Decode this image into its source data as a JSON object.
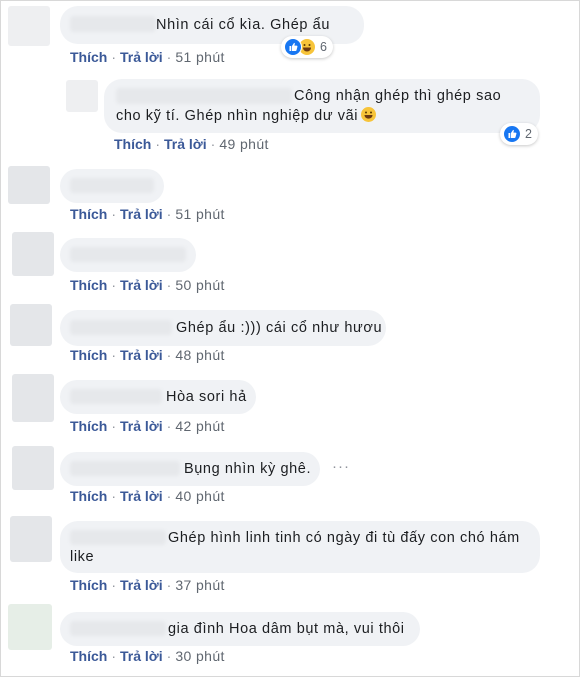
{
  "colors": {
    "link": "#3b5998",
    "bubble": "#f0f2f5",
    "time": "#606770",
    "like_blue": "#1877f2",
    "haha_yellow": "#f7c43a"
  },
  "labels": {
    "like": "Thích",
    "reply": "Trả lời",
    "dot": "·"
  },
  "comments": [
    {
      "text": "Nhìn cái cổ kìa. Ghép ẩu",
      "time": "51 phút",
      "reactions": {
        "icons": [
          "like-icon",
          "haha-icon"
        ],
        "count": "6"
      }
    },
    {
      "text": "Công nhận ghép thì ghép sao",
      "text2": "cho kỹ tí. Ghép nhìn nghiệp dư vãi",
      "emoji": "rolling-laughing-icon",
      "time": "49 phút",
      "reactions": {
        "icons": [
          "like-icon"
        ],
        "count": "2"
      }
    },
    {
      "text": "",
      "time": "51 phút"
    },
    {
      "text": "",
      "time": "50 phút"
    },
    {
      "text": "Ghép ẩu :))) cái cổ như hươu",
      "time": "48 phút"
    },
    {
      "text": "Hòa sori hả",
      "time": "42 phút"
    },
    {
      "text": "Bụng nhìn kỳ ghê.",
      "time": "40 phút",
      "more": "···"
    },
    {
      "text": "Ghép hình linh tinh có ngày đi tù đấy con chó hám",
      "text2": "like",
      "time": "37 phút"
    },
    {
      "text": "gia đình Hoa dâm bụt mà, vui thôi",
      "time": "30 phút"
    }
  ]
}
